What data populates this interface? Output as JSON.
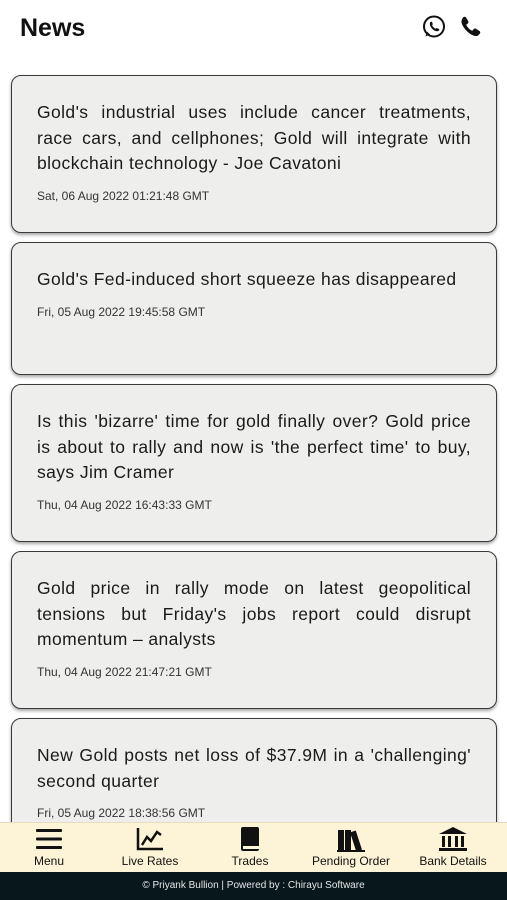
{
  "header": {
    "title": "News",
    "icons": [
      "whatsapp-icon",
      "phone-icon"
    ]
  },
  "news": [
    {
      "headline": "Gold's industrial uses include cancer treatments, race cars, and cellphones; Gold will integrate with blockchain technology - Joe Cavatoni",
      "date": "Sat, 06 Aug 2022 01:21:48 GMT"
    },
    {
      "headline": "Gold's Fed-induced short squeeze has disappeared",
      "date": "Fri, 05 Aug 2022 19:45:58 GMT"
    },
    {
      "headline": "Is this 'bizarre' time for gold finally over? Gold price is about to rally and now is 'the perfect time' to buy, says Jim Cramer",
      "date": "Thu, 04 Aug 2022 16:43:33 GMT"
    },
    {
      "headline": "Gold price in rally mode on latest geopolitical tensions but Friday's jobs report could disrupt momentum – analysts",
      "date": "Thu, 04 Aug 2022 21:47:21 GMT"
    },
    {
      "headline": "New Gold posts net loss of $37.9M in a 'challenging' second quarter",
      "date": "Fri, 05 Aug 2022 18:38:56 GMT"
    }
  ],
  "nav": [
    {
      "label": "Menu",
      "icon": "menu-icon"
    },
    {
      "label": "Live Rates",
      "icon": "chart-icon"
    },
    {
      "label": "Trades",
      "icon": "book-icon"
    },
    {
      "label": "Pending Order",
      "icon": "books-icon"
    },
    {
      "label": "Bank Details",
      "icon": "bank-icon"
    }
  ],
  "footer": {
    "text": "© Priyank Bullion | Powered by : Chirayu Software"
  },
  "colors": {
    "nav_background": "#fdf3d6",
    "footer_background": "#08171c",
    "card_background": "#eeeeec"
  }
}
